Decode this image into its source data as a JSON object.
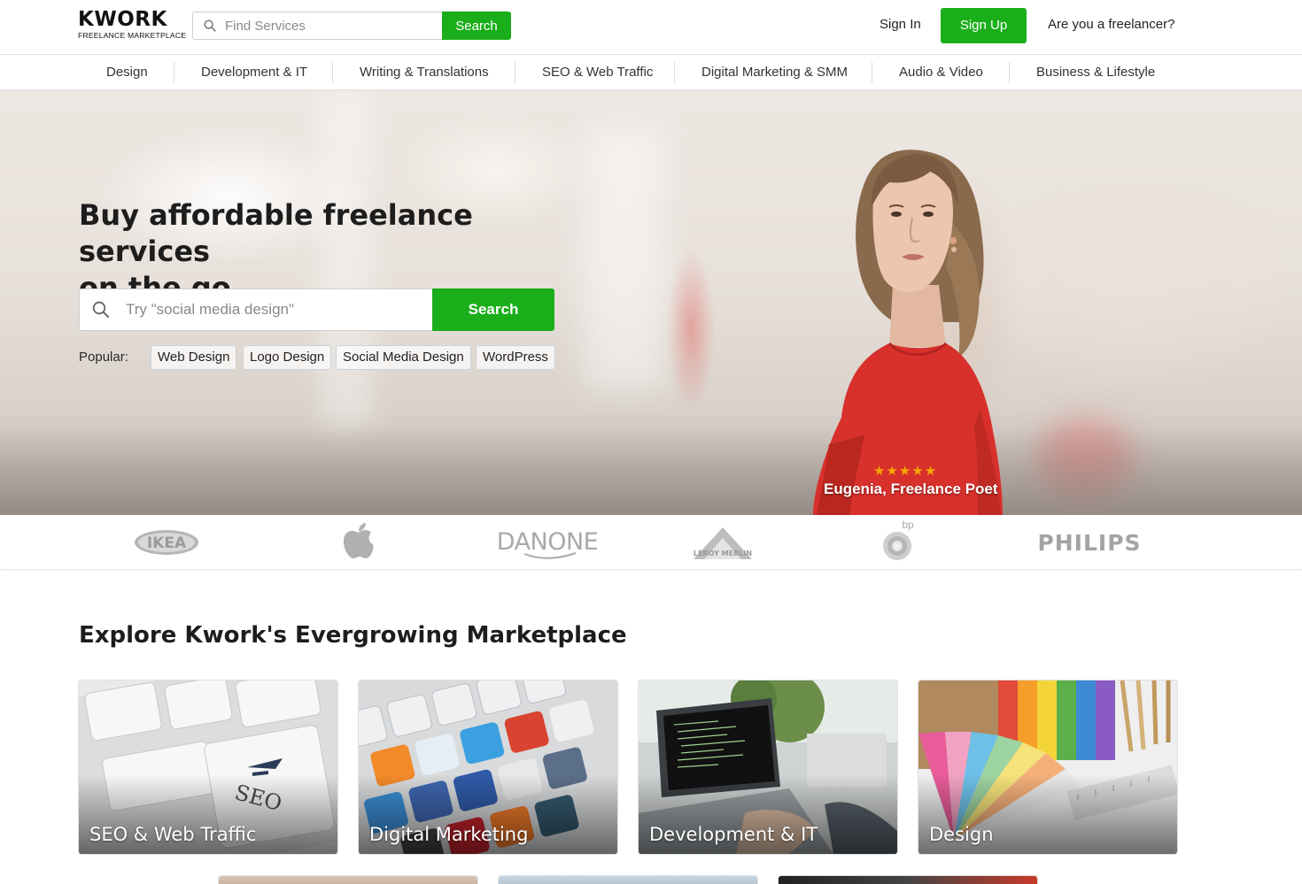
{
  "header": {
    "logo_word": "KWORK",
    "logo_sub": "FREELANCE MARKETPLACE",
    "search_placeholder": "Find Services",
    "search_button": "Search",
    "sign_in": "Sign In",
    "sign_up": "Sign Up",
    "freelancer_link": "Are you a freelancer?"
  },
  "categories": [
    "Design",
    "Development & IT",
    "Writing & Translations",
    "SEO & Web Traffic",
    "Digital Marketing & SMM",
    "Audio & Video",
    "Business & Lifestyle"
  ],
  "hero": {
    "title_line1": "Buy affordable freelance services",
    "title_line2": "on the go",
    "search_placeholder": "Try \"social media design\"",
    "search_button": "Search",
    "popular_label": "Popular:",
    "popular_tags": [
      "Web Design",
      "Logo Design",
      "Social Media Design",
      "WordPress"
    ],
    "rating_stars": "★★★★★",
    "freelancer_name": "Eugenia,",
    "freelancer_role": "Freelance Poet"
  },
  "brands": [
    "IKEA",
    "Apple",
    "DANONE",
    "LEROY MERLIN",
    "bp",
    "PHILIPS"
  ],
  "explore": {
    "title": "Explore Kwork's Evergrowing Marketplace",
    "cards": [
      "SEO & Web Traffic",
      "Digital Marketing",
      "Development & IT",
      "Design"
    ]
  },
  "colors": {
    "accent_green": "#1aae1a",
    "star_gold": "#f6a800",
    "hero_dress_red": "#d8302b"
  },
  "icons": {
    "search": "search-icon",
    "apple": "apple-logo-icon",
    "bp": "bp-sunflower-icon"
  }
}
